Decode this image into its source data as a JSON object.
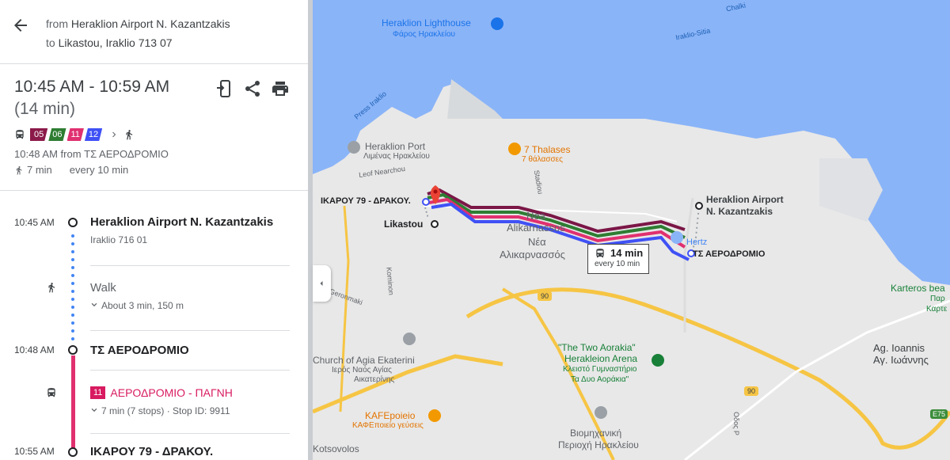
{
  "header": {
    "from_prefix": "from",
    "from_place": "Heraklion Airport N. Kazantzakis",
    "to_prefix": "to",
    "to_place": "Likastou, Iraklio 713 07"
  },
  "summary": {
    "time_range": "10:45 AM - 10:59 AM",
    "duration": "(14 min)",
    "routes": [
      {
        "label": "05",
        "color": "#8b1a4a"
      },
      {
        "label": "06",
        "color": "#2e7d32"
      },
      {
        "label": "11",
        "color": "#e0306f"
      },
      {
        "label": "12",
        "color": "#3f51f5"
      }
    ],
    "depart": "10:48 AM from ΤΣ ΑΕΡΟΔΡΟΜΙΟ",
    "walk": "7 min",
    "frequency": "every 10 min"
  },
  "actions": [
    "send-to-phone-icon",
    "share-icon",
    "print-icon"
  ],
  "timeline": {
    "start_time": "10:45 AM",
    "start_stop": "Heraklion Airport N. Kazantzakis",
    "start_address": "Iraklio 716 01",
    "walk_label": "Walk",
    "walk_detail": "About 3 min, 150 m",
    "board_time": "10:48 AM",
    "board_stop": "ΤΣ ΑΕΡΟΔΡΟΜΙΟ",
    "bus_number": "11",
    "bus_route": "ΑΕΡΟΔΡΟΜΙΟ - ΠΑΓΝΗ",
    "bus_detail": "7 min (7 stops) · Stop ID: 9911",
    "alight_time": "10:55 AM",
    "alight_stop": "ΙΚΑΡΟΥ 79 - ΔΡΑΚΟΥ."
  },
  "map": {
    "lighthouse": "Heraklion Lighthouse",
    "lighthouse_gr": "Φάρος Ηρακλείου",
    "port": "Heraklion Port",
    "port_gr": "Λιμένας Ηρακλείου",
    "thalases": "7 Thalases",
    "thalases_gr": "7 θάλασσες",
    "airport_line1": "Heraklion Airport",
    "airport_line2": "N. Kazantzakis",
    "stop_ikarou": "ΙΚΑΡΟΥ 79 - ΔΡΑΚΟΥ.",
    "likastou": "Likastou",
    "nea1": "Nea",
    "nea2": "Alikarnassos",
    "nea_gr1": "Νέα",
    "nea_gr2": "Αλικαρνασσός",
    "hertz": "Hertz",
    "ts_aerodromio": "ΤΣ ΑΕΡΟΔΡΟΜΙΟ",
    "card_time": "14 min",
    "card_freq": "every 10 min",
    "karteros": "Karteros bea",
    "karteros_gr1": "Παρ",
    "karteros_gr2": "Καρτε",
    "aorakia1": "\"The Two Aorakia\"",
    "aorakia2": "Herakleion Arena",
    "aorakia_gr1": "Κλειστό Γυμναστήριο",
    "aorakia_gr2": "Τα Δυο Αοράκια\"",
    "church1": "Church of Agia Ekaterini",
    "church_gr1": "Ιερός Ναός Αγίας",
    "church_gr2": "Αικατερίνης",
    "kafe": "KAFEpoieio",
    "kafe_gr": "ΚΑΦΕποιείο γεύσεις",
    "industrial1": "Βιομηχανική",
    "industrial2": "Περιοχή Ηρακλείου",
    "ioannis1": "Ag. Ioannis",
    "ioannis2": "Αγ. Ιωάννης",
    "kotsovolos": "Kotsovolos",
    "road_90a": "90",
    "road_90b": "90",
    "road_e75": "E75",
    "street_leof": "Leof Nearchou",
    "street_stadiou": "Stadiou",
    "street_kominon": "Kominon",
    "street_geronimaki": "Geronmaki",
    "street_odos": "Οδος Ρ",
    "street_irakliositia": "Irakliο-Sitia",
    "street_presa": "Press Iraklio",
    "street_chalki": "Chalki"
  },
  "colors": {
    "water": "#8ab4f8",
    "land": "#e8e8e8",
    "highway": "#f6c544",
    "accent_blue": "#4285f4"
  }
}
